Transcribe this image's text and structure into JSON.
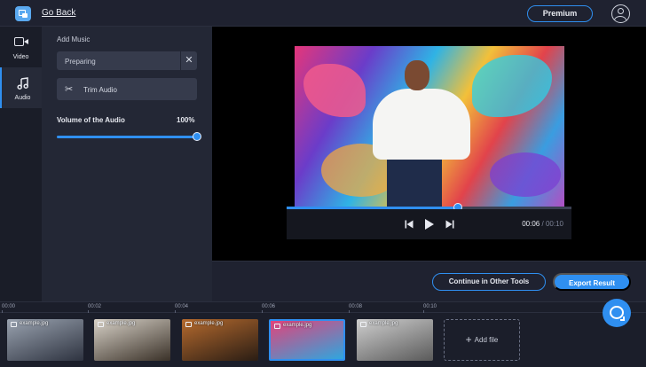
{
  "header": {
    "back_label": "Go Back",
    "premium_label": "Premium",
    "icons": {
      "logo": "app-logo-icon",
      "user": "user-account-icon"
    }
  },
  "rail": {
    "items": [
      {
        "label": "Video",
        "icon": "video-camera-icon",
        "active": false
      },
      {
        "label": "Audio",
        "icon": "music-note-icon",
        "active": true
      }
    ]
  },
  "audio_panel": {
    "title": "Add Music",
    "music_field_value": "Preparing",
    "clear_icon": "close-icon",
    "trim_label": "Trim Audio",
    "trim_icon": "scissors-icon",
    "volume_label": "Volume of the Audio",
    "volume_value": "100%",
    "volume_fraction": 1.0
  },
  "player": {
    "current_time": "00:06",
    "separator": "/",
    "duration": "00:10",
    "progress_fraction": 0.6,
    "icons": {
      "prev": "skip-previous-icon",
      "play": "play-icon",
      "next": "skip-next-icon"
    }
  },
  "actions": {
    "continue_label": "Continue in Other Tools",
    "export_label": "Export Result"
  },
  "timeline": {
    "ticks": [
      "00:00",
      "00:02",
      "00:04",
      "00:06",
      "00:08",
      "00:10"
    ],
    "clips": [
      {
        "name": "example.jpg",
        "selected": false,
        "colors": [
          "#9aa3b0",
          "#2e3340"
        ]
      },
      {
        "name": "example.jpg",
        "selected": false,
        "colors": [
          "#d8d2c8",
          "#3a3128"
        ]
      },
      {
        "name": "example.jpg",
        "selected": false,
        "colors": [
          "#b56a2e",
          "#2a1d14"
        ]
      },
      {
        "name": "example.jpg",
        "selected": true,
        "colors": [
          "#e2437a",
          "#2fa6de"
        ]
      },
      {
        "name": "example.jpg",
        "selected": false,
        "colors": [
          "#cfcfcf",
          "#5a5a5a"
        ]
      }
    ],
    "add_file_label": "Add file",
    "add_icon": "plus-icon"
  },
  "chat_icon": "chat-support-icon"
}
